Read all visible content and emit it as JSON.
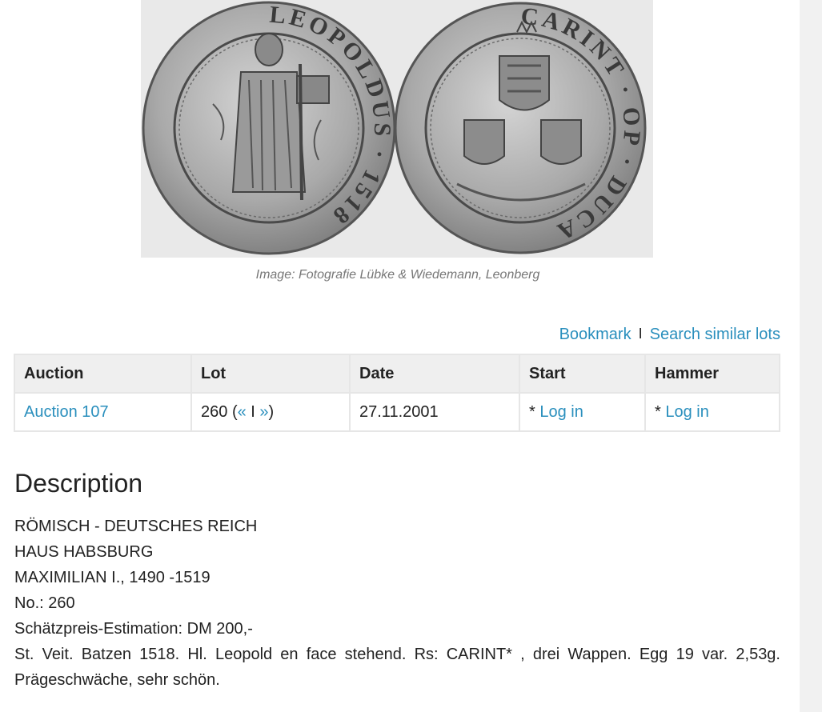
{
  "image": {
    "caption": "Image: Fotografie Lübke & Wiedemann, Leonberg",
    "obverse_legend": "LEOPOLDUS · 1518",
    "reverse_legend": "CARINT · OP · DUCA"
  },
  "actions": {
    "bookmark": "Bookmark",
    "separator": "I",
    "search_similar": "Search similar lots"
  },
  "table": {
    "headers": {
      "auction": "Auction",
      "lot": "Lot",
      "date": "Date",
      "start": "Start",
      "hammer": "Hammer"
    },
    "row": {
      "auction": "Auction 107",
      "lot_number": "260",
      "lot_open": "(",
      "prev": "«",
      "nav_sep": "I",
      "next": "»",
      "lot_close": ")",
      "date": "27.11.2001",
      "start_prefix": "*",
      "start_link": "Log in",
      "hammer_prefix": "*",
      "hammer_link": "Log in"
    }
  },
  "description": {
    "heading": "Description",
    "lines": [
      "RÖMISCH - DEUTSCHES REICH",
      "HAUS HABSBURG",
      "MAXIMILIAN I., 1490 -1519",
      "No.: 260",
      "Schätzpreis-Estimation: DM 200,-"
    ],
    "text": "St. Veit. Batzen 1518. Hl. Leopold en face stehend. Rs: CARINT* , drei Wappen. Egg 19 var. 2,53g. Prägeschwäche, sehr schön."
  },
  "colors": {
    "link": "#2a8fbd",
    "header_bg": "#efefef",
    "caption": "#777777",
    "scroll_gutter": "#f1f1f1"
  }
}
